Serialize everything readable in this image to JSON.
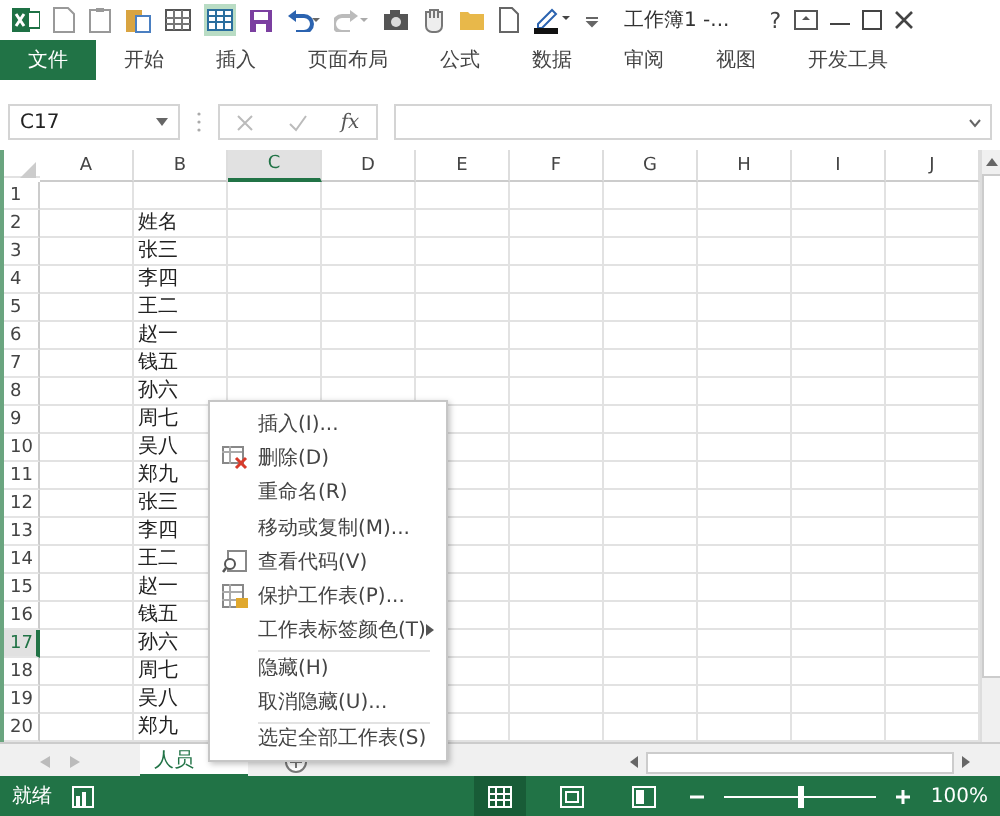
{
  "window": {
    "title": "工作簿1 -..."
  },
  "help": "?",
  "ribbon_tabs": [
    {
      "label": "文件",
      "selected": true
    },
    {
      "label": "开始",
      "selected": false
    },
    {
      "label": "插入",
      "selected": false
    },
    {
      "label": "页面布局",
      "selected": false
    },
    {
      "label": "公式",
      "selected": false
    },
    {
      "label": "数据",
      "selected": false
    },
    {
      "label": "审阅",
      "selected": false
    },
    {
      "label": "视图",
      "selected": false
    },
    {
      "label": "开发工具",
      "selected": false
    }
  ],
  "formula_bar": {
    "name_box": "C17",
    "function_label": "fx"
  },
  "columns": [
    {
      "label": "A",
      "selected": false
    },
    {
      "label": "B",
      "selected": false
    },
    {
      "label": "C",
      "selected": true
    },
    {
      "label": "D",
      "selected": false
    },
    {
      "label": "E",
      "selected": false
    },
    {
      "label": "F",
      "selected": false
    },
    {
      "label": "G",
      "selected": false
    },
    {
      "label": "H",
      "selected": false
    },
    {
      "label": "I",
      "selected": false
    },
    {
      "label": "J",
      "selected": false
    }
  ],
  "rows": [
    {
      "number": "1",
      "selected": false
    },
    {
      "number": "2",
      "selected": false,
      "b": "姓名"
    },
    {
      "number": "3",
      "selected": false,
      "b": "张三"
    },
    {
      "number": "4",
      "selected": false,
      "b": "李四"
    },
    {
      "number": "5",
      "selected": false,
      "b": "王二"
    },
    {
      "number": "6",
      "selected": false,
      "b": "赵一"
    },
    {
      "number": "7",
      "selected": false,
      "b": "钱五"
    },
    {
      "number": "8",
      "selected": false,
      "b": "孙六"
    },
    {
      "number": "9",
      "selected": false,
      "b": "周七"
    },
    {
      "number": "10",
      "selected": false,
      "b": "吴八"
    },
    {
      "number": "11",
      "selected": false,
      "b": "郑九"
    },
    {
      "number": "12",
      "selected": false,
      "b": "张三"
    },
    {
      "number": "13",
      "selected": false,
      "b": "李四"
    },
    {
      "number": "14",
      "selected": false,
      "b": "王二"
    },
    {
      "number": "15",
      "selected": false,
      "b": "赵一"
    },
    {
      "number": "16",
      "selected": false,
      "b": "钱五"
    },
    {
      "number": "17",
      "selected": true,
      "b": "孙六"
    },
    {
      "number": "18",
      "selected": false,
      "b": "周七"
    },
    {
      "number": "19",
      "selected": false,
      "b": "吴八"
    },
    {
      "number": "20",
      "selected": false,
      "b": "郑九"
    }
  ],
  "sheet_tabs": [
    {
      "label": "人员",
      "selected": true
    }
  ],
  "context_menu": [
    {
      "label": "插入(I)...",
      "kind": "plain",
      "separator_before": false,
      "submenu": false
    },
    {
      "label": "删除(D)",
      "kind": "delete",
      "separator_before": false,
      "submenu": false
    },
    {
      "label": "重命名(R)",
      "kind": "plain",
      "separator_before": false,
      "submenu": false
    },
    {
      "label": "移动或复制(M)...",
      "kind": "plain",
      "separator_before": false,
      "submenu": false
    },
    {
      "label": "查看代码(V)",
      "kind": "code",
      "separator_before": false,
      "submenu": false
    },
    {
      "label": "保护工作表(P)...",
      "kind": "protect",
      "separator_before": false,
      "submenu": false
    },
    {
      "label": "工作表标签颜色(T)",
      "kind": "plain",
      "separator_before": false,
      "submenu": true
    },
    {
      "label": "隐藏(H)",
      "kind": "plain",
      "separator_before": true,
      "submenu": false
    },
    {
      "label": "取消隐藏(U)...",
      "kind": "plain",
      "separator_before": false,
      "submenu": false
    },
    {
      "label": "选定全部工作表(S)",
      "kind": "plain",
      "separator_before": true,
      "submenu": false
    }
  ],
  "status_bar": {
    "status": "就绪",
    "zoom": "100%",
    "zoom_slider": {
      "level": 0.5
    }
  }
}
